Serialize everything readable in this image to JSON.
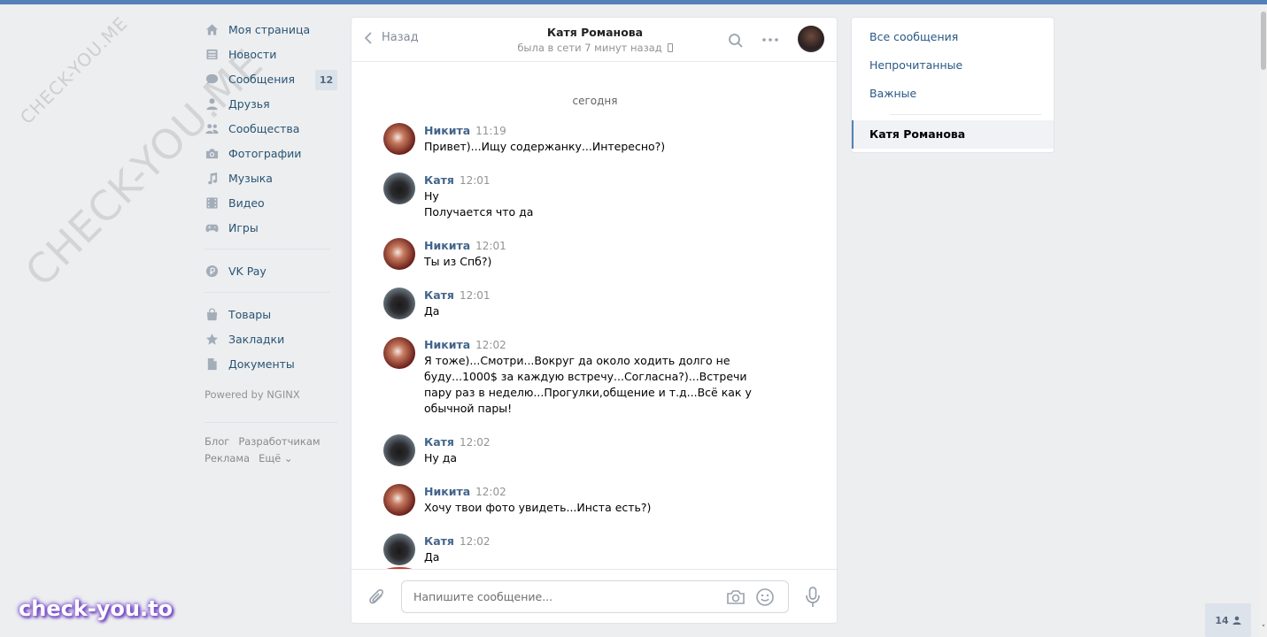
{
  "sidebar": {
    "items": [
      {
        "label": "Моя страница",
        "icon": "home-icon"
      },
      {
        "label": "Новости",
        "icon": "news-icon"
      },
      {
        "label": "Сообщения",
        "icon": "messages-icon"
      },
      {
        "label": "Друзья",
        "icon": "friends-icon"
      },
      {
        "label": "Сообщества",
        "icon": "communities-icon"
      },
      {
        "label": "Фотографии",
        "icon": "photos-icon"
      },
      {
        "label": "Музыка",
        "icon": "music-icon"
      },
      {
        "label": "Видео",
        "icon": "video-icon"
      },
      {
        "label": "Игры",
        "icon": "games-icon"
      },
      {
        "label": "VK Pay",
        "icon": "vkpay-icon"
      },
      {
        "label": "Товары",
        "icon": "goods-icon"
      },
      {
        "label": "Закладки",
        "icon": "bookmarks-icon"
      },
      {
        "label": "Документы",
        "icon": "documents-icon"
      }
    ],
    "messages_badge": "12",
    "powered": "Powered by NGINX",
    "footer": [
      "Блог",
      "Разработчикам",
      "Реклама",
      "Ещё ⌄"
    ]
  },
  "chat": {
    "back_label": "Назад",
    "peer_name": "Катя Романова",
    "peer_status": "была в сети 7 минут назад",
    "day_label": "сегодня",
    "messages": [
      {
        "author": "Никита",
        "time": "11:19",
        "lines": [
          "Привет)...Ищу содержанку...Интересно?)"
        ]
      },
      {
        "author": "Катя",
        "time": "12:01",
        "lines": [
          "Ну",
          "Получается что да"
        ]
      },
      {
        "author": "Никита",
        "time": "12:01",
        "lines": [
          "Ты из Спб?)"
        ]
      },
      {
        "author": "Катя",
        "time": "12:01",
        "lines": [
          "Да"
        ]
      },
      {
        "author": "Никита",
        "time": "12:02",
        "lines": [
          "Я тоже)...Смотри...Вокруг да около ходить долго не буду...1000$ за каждую встречу...Согласна?)...Встречи пару раз в неделю...Прогулки,общение и т.д...Всё как у обычной пары!"
        ]
      },
      {
        "author": "Катя",
        "time": "12:02",
        "lines": [
          "Ну да"
        ]
      },
      {
        "author": "Никита",
        "time": "12:02",
        "lines": [
          "Хочу твои фото увидеть...Инста есть?)"
        ]
      },
      {
        "author": "Катя",
        "time": "12:02",
        "lines": [
          "Да"
        ]
      }
    ],
    "composer_placeholder": "Напишите сообщение..."
  },
  "rightmenu": {
    "items": [
      "Все сообщения",
      "Непрочитанные",
      "Важные"
    ],
    "active": "Катя Романова"
  },
  "online_count": "14",
  "watermarks": {
    "small": "CHECK-YOU.ME",
    "big": "CHECK-YOU.ME",
    "brand": "check-you.to"
  }
}
